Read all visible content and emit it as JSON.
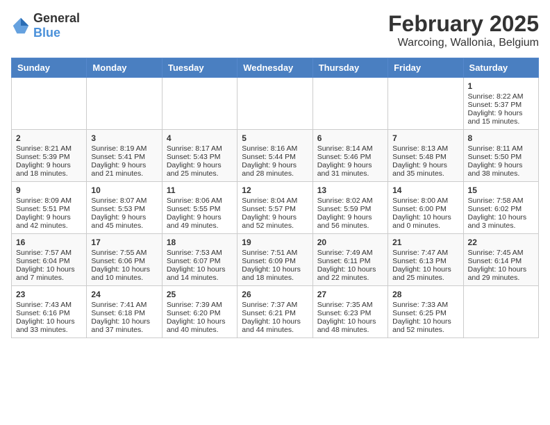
{
  "header": {
    "logo_general": "General",
    "logo_blue": "Blue",
    "title": "February 2025",
    "subtitle": "Warcoing, Wallonia, Belgium"
  },
  "days_of_week": [
    "Sunday",
    "Monday",
    "Tuesday",
    "Wednesday",
    "Thursday",
    "Friday",
    "Saturday"
  ],
  "weeks": [
    [
      {
        "day": "",
        "content": ""
      },
      {
        "day": "",
        "content": ""
      },
      {
        "day": "",
        "content": ""
      },
      {
        "day": "",
        "content": ""
      },
      {
        "day": "",
        "content": ""
      },
      {
        "day": "",
        "content": ""
      },
      {
        "day": "1",
        "content": "Sunrise: 8:22 AM\nSunset: 5:37 PM\nDaylight: 9 hours and 15 minutes."
      }
    ],
    [
      {
        "day": "2",
        "content": "Sunrise: 8:21 AM\nSunset: 5:39 PM\nDaylight: 9 hours and 18 minutes."
      },
      {
        "day": "3",
        "content": "Sunrise: 8:19 AM\nSunset: 5:41 PM\nDaylight: 9 hours and 21 minutes."
      },
      {
        "day": "4",
        "content": "Sunrise: 8:17 AM\nSunset: 5:43 PM\nDaylight: 9 hours and 25 minutes."
      },
      {
        "day": "5",
        "content": "Sunrise: 8:16 AM\nSunset: 5:44 PM\nDaylight: 9 hours and 28 minutes."
      },
      {
        "day": "6",
        "content": "Sunrise: 8:14 AM\nSunset: 5:46 PM\nDaylight: 9 hours and 31 minutes."
      },
      {
        "day": "7",
        "content": "Sunrise: 8:13 AM\nSunset: 5:48 PM\nDaylight: 9 hours and 35 minutes."
      },
      {
        "day": "8",
        "content": "Sunrise: 8:11 AM\nSunset: 5:50 PM\nDaylight: 9 hours and 38 minutes."
      }
    ],
    [
      {
        "day": "9",
        "content": "Sunrise: 8:09 AM\nSunset: 5:51 PM\nDaylight: 9 hours and 42 minutes."
      },
      {
        "day": "10",
        "content": "Sunrise: 8:07 AM\nSunset: 5:53 PM\nDaylight: 9 hours and 45 minutes."
      },
      {
        "day": "11",
        "content": "Sunrise: 8:06 AM\nSunset: 5:55 PM\nDaylight: 9 hours and 49 minutes."
      },
      {
        "day": "12",
        "content": "Sunrise: 8:04 AM\nSunset: 5:57 PM\nDaylight: 9 hours and 52 minutes."
      },
      {
        "day": "13",
        "content": "Sunrise: 8:02 AM\nSunset: 5:59 PM\nDaylight: 9 hours and 56 minutes."
      },
      {
        "day": "14",
        "content": "Sunrise: 8:00 AM\nSunset: 6:00 PM\nDaylight: 10 hours and 0 minutes."
      },
      {
        "day": "15",
        "content": "Sunrise: 7:58 AM\nSunset: 6:02 PM\nDaylight: 10 hours and 3 minutes."
      }
    ],
    [
      {
        "day": "16",
        "content": "Sunrise: 7:57 AM\nSunset: 6:04 PM\nDaylight: 10 hours and 7 minutes."
      },
      {
        "day": "17",
        "content": "Sunrise: 7:55 AM\nSunset: 6:06 PM\nDaylight: 10 hours and 10 minutes."
      },
      {
        "day": "18",
        "content": "Sunrise: 7:53 AM\nSunset: 6:07 PM\nDaylight: 10 hours and 14 minutes."
      },
      {
        "day": "19",
        "content": "Sunrise: 7:51 AM\nSunset: 6:09 PM\nDaylight: 10 hours and 18 minutes."
      },
      {
        "day": "20",
        "content": "Sunrise: 7:49 AM\nSunset: 6:11 PM\nDaylight: 10 hours and 22 minutes."
      },
      {
        "day": "21",
        "content": "Sunrise: 7:47 AM\nSunset: 6:13 PM\nDaylight: 10 hours and 25 minutes."
      },
      {
        "day": "22",
        "content": "Sunrise: 7:45 AM\nSunset: 6:14 PM\nDaylight: 10 hours and 29 minutes."
      }
    ],
    [
      {
        "day": "23",
        "content": "Sunrise: 7:43 AM\nSunset: 6:16 PM\nDaylight: 10 hours and 33 minutes."
      },
      {
        "day": "24",
        "content": "Sunrise: 7:41 AM\nSunset: 6:18 PM\nDaylight: 10 hours and 37 minutes."
      },
      {
        "day": "25",
        "content": "Sunrise: 7:39 AM\nSunset: 6:20 PM\nDaylight: 10 hours and 40 minutes."
      },
      {
        "day": "26",
        "content": "Sunrise: 7:37 AM\nSunset: 6:21 PM\nDaylight: 10 hours and 44 minutes."
      },
      {
        "day": "27",
        "content": "Sunrise: 7:35 AM\nSunset: 6:23 PM\nDaylight: 10 hours and 48 minutes."
      },
      {
        "day": "28",
        "content": "Sunrise: 7:33 AM\nSunset: 6:25 PM\nDaylight: 10 hours and 52 minutes."
      },
      {
        "day": "",
        "content": ""
      }
    ]
  ]
}
